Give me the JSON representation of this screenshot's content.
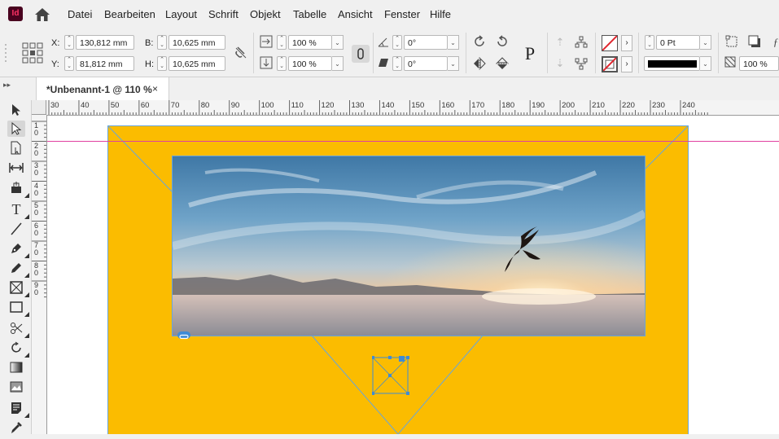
{
  "app": {
    "logo_text": "Id",
    "brand_color": "#49021f"
  },
  "menu": [
    "Datei",
    "Bearbeiten",
    "Layout",
    "Schrift",
    "Objekt",
    "Tabelle",
    "Ansicht",
    "Fenster",
    "Hilfe"
  ],
  "control": {
    "x_label": "X:",
    "x_value": "130,812 mm",
    "y_label": "Y:",
    "y_value": "81,812 mm",
    "w_label": "B:",
    "w_value": "10,625 mm",
    "h_label": "H:",
    "h_value": "10,625 mm",
    "scale_x": "100 %",
    "scale_y": "100 %",
    "rotate": "0°",
    "shear": "0°",
    "stroke_weight": "0 Pt",
    "opacity": "100 %",
    "frame_label": "P"
  },
  "tab": {
    "title": "*Unbenannt-1 @ 110 %",
    "close": "×"
  },
  "ruler": {
    "h_ticks": [
      "30",
      "40",
      "50",
      "60",
      "70",
      "80",
      "90",
      "100",
      "110",
      "120",
      "130",
      "140",
      "150",
      "160",
      "170",
      "180",
      "190",
      "200",
      "210",
      "220",
      "230",
      "240"
    ],
    "v_ticks": [
      "1",
      "2",
      "3",
      "4",
      "5",
      "6",
      "7",
      "8",
      "9"
    ]
  },
  "colors": {
    "page_fill": "#fbbc00",
    "guide": "#e040a0",
    "frame": "#6aa6d8",
    "selection": "#3f8bd6"
  }
}
